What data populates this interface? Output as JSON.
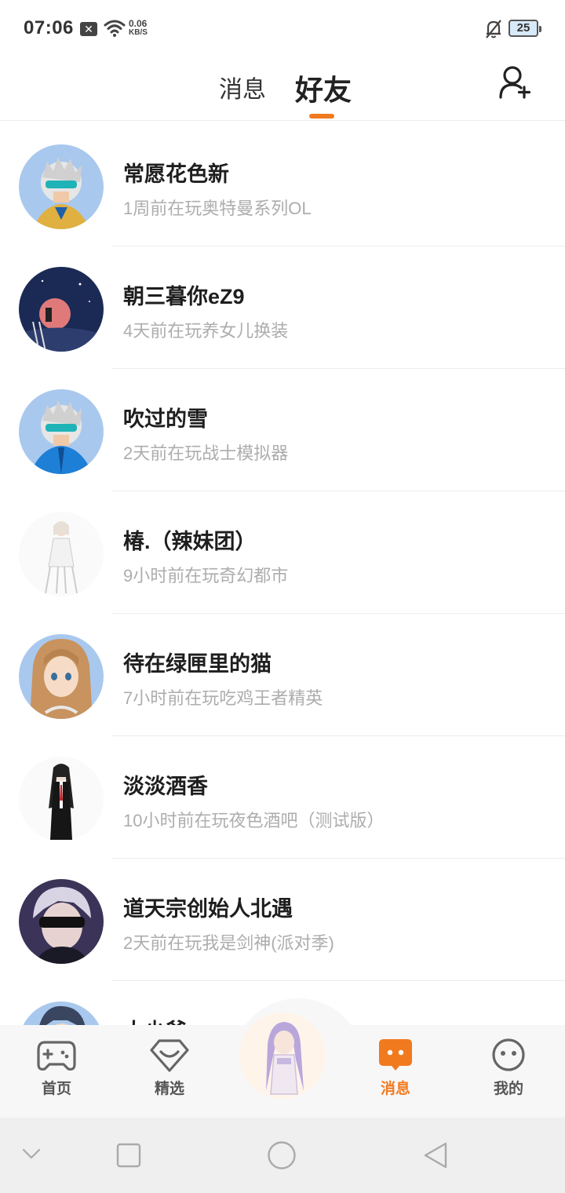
{
  "status": {
    "time": "07:06",
    "notification_icon": "x-notification-icon",
    "net_speed_value": "0.06",
    "net_speed_unit": "KB/S",
    "battery": "25"
  },
  "header": {
    "tab_messages": "消息",
    "tab_friends": "好友",
    "active_tab": "好友",
    "accent": "#f17a1f"
  },
  "friends": [
    {
      "name": "常愿花色新",
      "activity": "1周前在玩奥特曼系列OL"
    },
    {
      "name": "朝三暮你eZ9",
      "activity": "4天前在玩养女儿换装"
    },
    {
      "name": "吹过的雪",
      "activity": "2天前在玩战士模拟器"
    },
    {
      "name": "椿.（辣妹团）",
      "activity": "9小时前在玩奇幻都市"
    },
    {
      "name": "待在绿匣里的猫",
      "activity": "7小时前在玩吃鸡王者精英"
    },
    {
      "name": "淡淡酒香",
      "activity": "10小时前在玩夜色酒吧（测试版）"
    },
    {
      "name": "道天宗创始人北遇",
      "activity": "2天前在玩我是剑神(派对季)"
    },
    {
      "name": "大少爷",
      "activity": ""
    }
  ],
  "bottom_nav": {
    "home": "首页",
    "featured": "精选",
    "messages": "消息",
    "mine": "我的",
    "active": "消息"
  }
}
